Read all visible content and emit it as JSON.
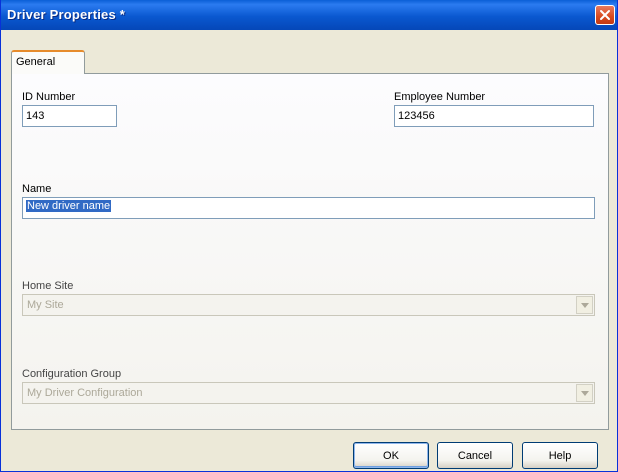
{
  "window": {
    "title": "Driver Properties *"
  },
  "tabs": [
    {
      "label": "General"
    }
  ],
  "fields": {
    "id_number": {
      "label": "ID Number",
      "value": "143"
    },
    "employee_number": {
      "label": "Employee Number",
      "value": "123456"
    },
    "name": {
      "label": "Name",
      "value": "New driver name"
    },
    "home_site": {
      "label": "Home Site",
      "value": "My Site"
    },
    "configuration_group": {
      "label": "Configuration Group",
      "value": "My Driver Configuration"
    }
  },
  "buttons": {
    "ok": "OK",
    "cancel": "Cancel",
    "help": "Help"
  },
  "icons": {
    "close": "close-icon",
    "dropdown": "chevron-down-icon"
  },
  "colors": {
    "titlebar": "#0a58d0",
    "close": "#d8491d",
    "selection": "#316ac5",
    "tab_accent": "#e68b2c"
  }
}
